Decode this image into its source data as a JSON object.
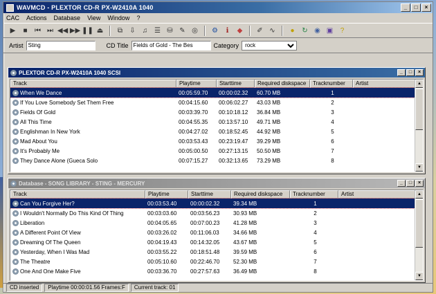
{
  "window": {
    "title": "WAVMCD - PLEXTOR CD-R PX-W2410A 1040 ",
    "title_rest": "SCSI",
    "min": "_",
    "max": "□",
    "close": "×"
  },
  "menu": [
    "CAC",
    "Actions",
    "Database",
    "View",
    "Window",
    "?"
  ],
  "toolbar_icons": [
    "play-icon",
    "stop-icon",
    "prev-icon",
    "next-icon",
    "rewind-icon",
    "forward-icon",
    "pause-icon",
    "eject-icon",
    "copy-icon",
    "rip-icon",
    "track-icon",
    "playlist-icon",
    "database-icon",
    "edit-icon",
    "cddb-icon",
    "settings-icon",
    "info-icon",
    "color-icon",
    "pencil-icon",
    "wave-icon",
    "gold-icon",
    "refresh-icon",
    "cd-icon",
    "disk-icon",
    "help-icon"
  ],
  "infobar": {
    "artist_label": "Artist",
    "artist_value": "Sting",
    "cd_title_label": "CD Title",
    "cd_title_value": "Fields of Gold - The Bes",
    "category_label": "Category",
    "category_value": "rock"
  },
  "columns": [
    "Track",
    "Playtime",
    "Starttime",
    "Required diskspace",
    "Tracknumber",
    "Artist"
  ],
  "top_window": {
    "title": "PLEXTOR CD-R PX-W2410A 1040 SCSI",
    "rows": [
      {
        "track": "When We Dance",
        "playtime": "00:05:59.70",
        "start": "00:00:02.32",
        "size": "60.70 MB",
        "num": "1",
        "artist": ""
      },
      {
        "track": "If You Love Somebody Set Them Free",
        "playtime": "00:04:15.60",
        "start": "00:06:02.27",
        "size": "43.03 MB",
        "num": "2",
        "artist": ""
      },
      {
        "track": "Fields Of Gold",
        "playtime": "00:03:39.70",
        "start": "00:10:18.12",
        "size": "36.84 MB",
        "num": "3",
        "artist": ""
      },
      {
        "track": "All This Time",
        "playtime": "00:04:55.35",
        "start": "00:13:57.10",
        "size": "49.71 MB",
        "num": "4",
        "artist": ""
      },
      {
        "track": "Englishman In New York",
        "playtime": "00:04:27.02",
        "start": "00:18:52.45",
        "size": "44.92 MB",
        "num": "5",
        "artist": ""
      },
      {
        "track": "Mad About You",
        "playtime": "00:03:53.43",
        "start": "00:23:19.47",
        "size": "39.29 MB",
        "num": "6",
        "artist": ""
      },
      {
        "track": "It's Probably Me",
        "playtime": "00:05:00.50",
        "start": "00:27:13.15",
        "size": "50.50 MB",
        "num": "7",
        "artist": ""
      },
      {
        "track": "They Dance Alone (Gueca Solo",
        "playtime": "00:07:15.27",
        "start": "00:32:13.65",
        "size": "73.29 MB",
        "num": "8",
        "artist": ""
      }
    ]
  },
  "bottom_window": {
    "title": "Database - SONG LIBRARY - STING - MERCURY",
    "rows": [
      {
        "track": "Can You Forgive Her?",
        "playtime": "00:03:53.40",
        "start": "00:00:02.32",
        "size": "39.34 MB",
        "num": "1",
        "artist": ""
      },
      {
        "track": "I Wouldn't Normally Do This Kind Of Thing",
        "playtime": "00:03:03.60",
        "start": "00:03:56.23",
        "size": "30.93 MB",
        "num": "2",
        "artist": ""
      },
      {
        "track": "Liberation",
        "playtime": "00:04:05.65",
        "start": "00:07:00.23",
        "size": "41.28 MB",
        "num": "3",
        "artist": ""
      },
      {
        "track": "A Different Point Of View",
        "playtime": "00:03:26.02",
        "start": "00:11:06.03",
        "size": "34.66 MB",
        "num": "4",
        "artist": ""
      },
      {
        "track": "Dreaming Of The Queen",
        "playtime": "00:04:19.43",
        "start": "00:14:32.05",
        "size": "43.67 MB",
        "num": "5",
        "artist": ""
      },
      {
        "track": "Yesterday, When I Was Mad",
        "playtime": "00:03:55.22",
        "start": "00:18:51.48",
        "size": "39.59 MB",
        "num": "6",
        "artist": ""
      },
      {
        "track": "The Theatre",
        "playtime": "00:05:10.60",
        "start": "00:22:46.70",
        "size": "52.30 MB",
        "num": "7",
        "artist": ""
      },
      {
        "track": "One And One Make Five",
        "playtime": "00:03:36.70",
        "start": "00:27:57.63",
        "size": "36.49 MB",
        "num": "8",
        "artist": ""
      }
    ]
  },
  "status": {
    "left": "CD inserted",
    "playtime": "Playtime 00:00:01.56 Frames:F",
    "current": "Current track: 01"
  }
}
